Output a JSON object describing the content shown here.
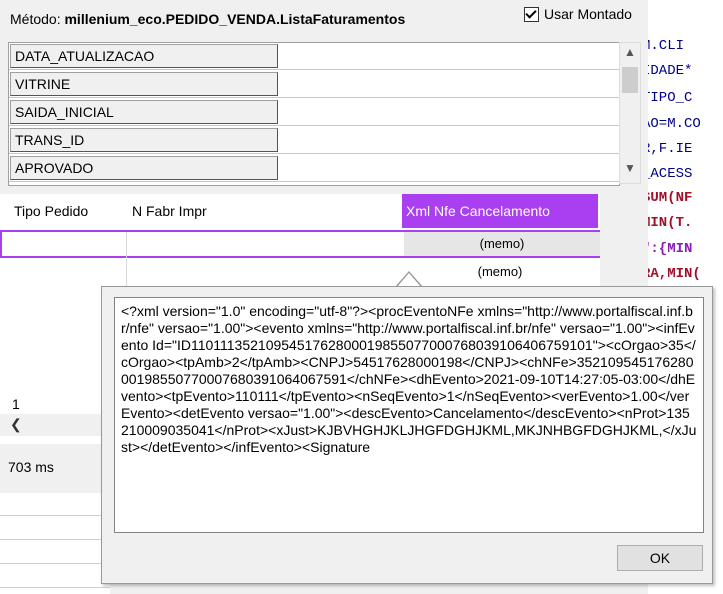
{
  "header": {
    "metodo_label": "Método:",
    "metodo_value": "millenium_eco.PEDIDO_VENDA.ListaFaturamentos",
    "usar_montado": "Usar Montado"
  },
  "fields": [
    "DATA_ATUALIZACAO",
    "VITRINE",
    "SAIDA_INICIAL",
    "TRANS_ID",
    "APROVADO"
  ],
  "grid": {
    "columns": [
      "Tipo Pedido",
      "N Fabr Impr",
      "Xml Nfe Cancelamento"
    ],
    "rows": [
      "(memo)",
      "(memo)"
    ]
  },
  "footer": {
    "row_count": "1",
    "elapsed": "703 ms"
  },
  "popup": {
    "xml": "<?xml version=\"1.0\" encoding=\"utf-8\"?><procEventoNFe xmlns=\"http://www.portalfiscal.inf.br/nfe\" versao=\"1.00\"><evento xmlns=\"http://www.portalfiscal.inf.br/nfe\" versao=\"1.00\"><infEvento Id=\"ID1101113521095451762800019855077000768039106406759101\"><cOrgao>35</cOrgao><tpAmb>2</tpAmb><CNPJ>54517628000198</CNPJ><chNFe>35210954517628000198550770007680391064067591</chNFe><dhEvento>2021-09-10T14:27:05-03:00</dhEvento><tpEvento>110111</tpEvento><nSeqEvento>1</nSeqEvento><verEvento>1.00</verEvento><detEvento versao=\"1.00\"><descEvento>Cancelamento</descEvento><nProt>135210009035041</nProt><xJust>KJBVHGHJKLJHGFDGHJKML,MKJNHBGFDGHJKML,</xJust></detEvento></infEvento><Signature",
    "ok_label": "OK"
  },
  "code_editor": {
    "lines": [
      "M.CLI",
      "IDADE*",
      "TIPO_C",
      "AO=M.CO",
      "R,F.IE",
      "_ACESS",
      "SUM(NF",
      "MIN(T.",
      "\":{MIN",
      "RA,MIN("
    ]
  }
}
